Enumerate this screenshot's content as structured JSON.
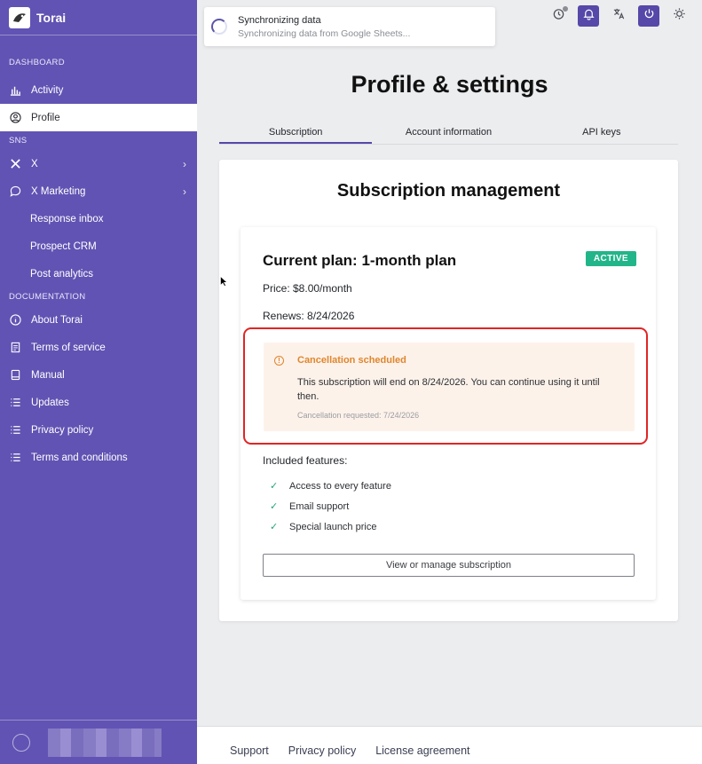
{
  "app": {
    "name": "Torai"
  },
  "sidebar": {
    "sections": {
      "dashboard": "DASHBOARD",
      "sns": "SNS",
      "documentation": "DOCUMENTATION"
    },
    "items": {
      "activity": "Activity",
      "profile": "Profile",
      "x": "X",
      "x_marketing": "X Marketing",
      "response_inbox": "Response inbox",
      "prospect_crm": "Prospect CRM",
      "post_analytics": "Post analytics",
      "about": "About Torai",
      "terms_service": "Terms of service",
      "manual": "Manual",
      "updates": "Updates",
      "privacy": "Privacy policy",
      "terms_conditions": "Terms and conditions"
    }
  },
  "toast": {
    "title": "Synchronizing data",
    "message": "Synchronizing data from Google Sheets..."
  },
  "page": {
    "title": "Profile & settings"
  },
  "tabs": [
    "Subscription",
    "Account information",
    "API keys"
  ],
  "subscription": {
    "heading": "Subscription management",
    "plan_title": "Current plan: 1-month plan",
    "status": "ACTIVE",
    "price": "Price: $8.00/month",
    "renews": "Renews: 8/24/2026",
    "alert": {
      "title": "Cancellation scheduled",
      "body": "This subscription will end on 8/24/2026. You can continue using it until then.",
      "note": "Cancellation requested: 7/24/2026"
    },
    "features_label": "Included features:",
    "features": [
      "Access to every feature",
      "Email support",
      "Special launch price"
    ],
    "manage_button": "View or manage subscription"
  },
  "footer": {
    "support": "Support",
    "privacy": "Privacy policy",
    "license": "License agreement"
  },
  "colors": {
    "sidebar": "#6153b3",
    "accent": "#5548a8",
    "active_badge": "#23b58a",
    "warning": "#e0862c",
    "highlight": "#e02525"
  }
}
